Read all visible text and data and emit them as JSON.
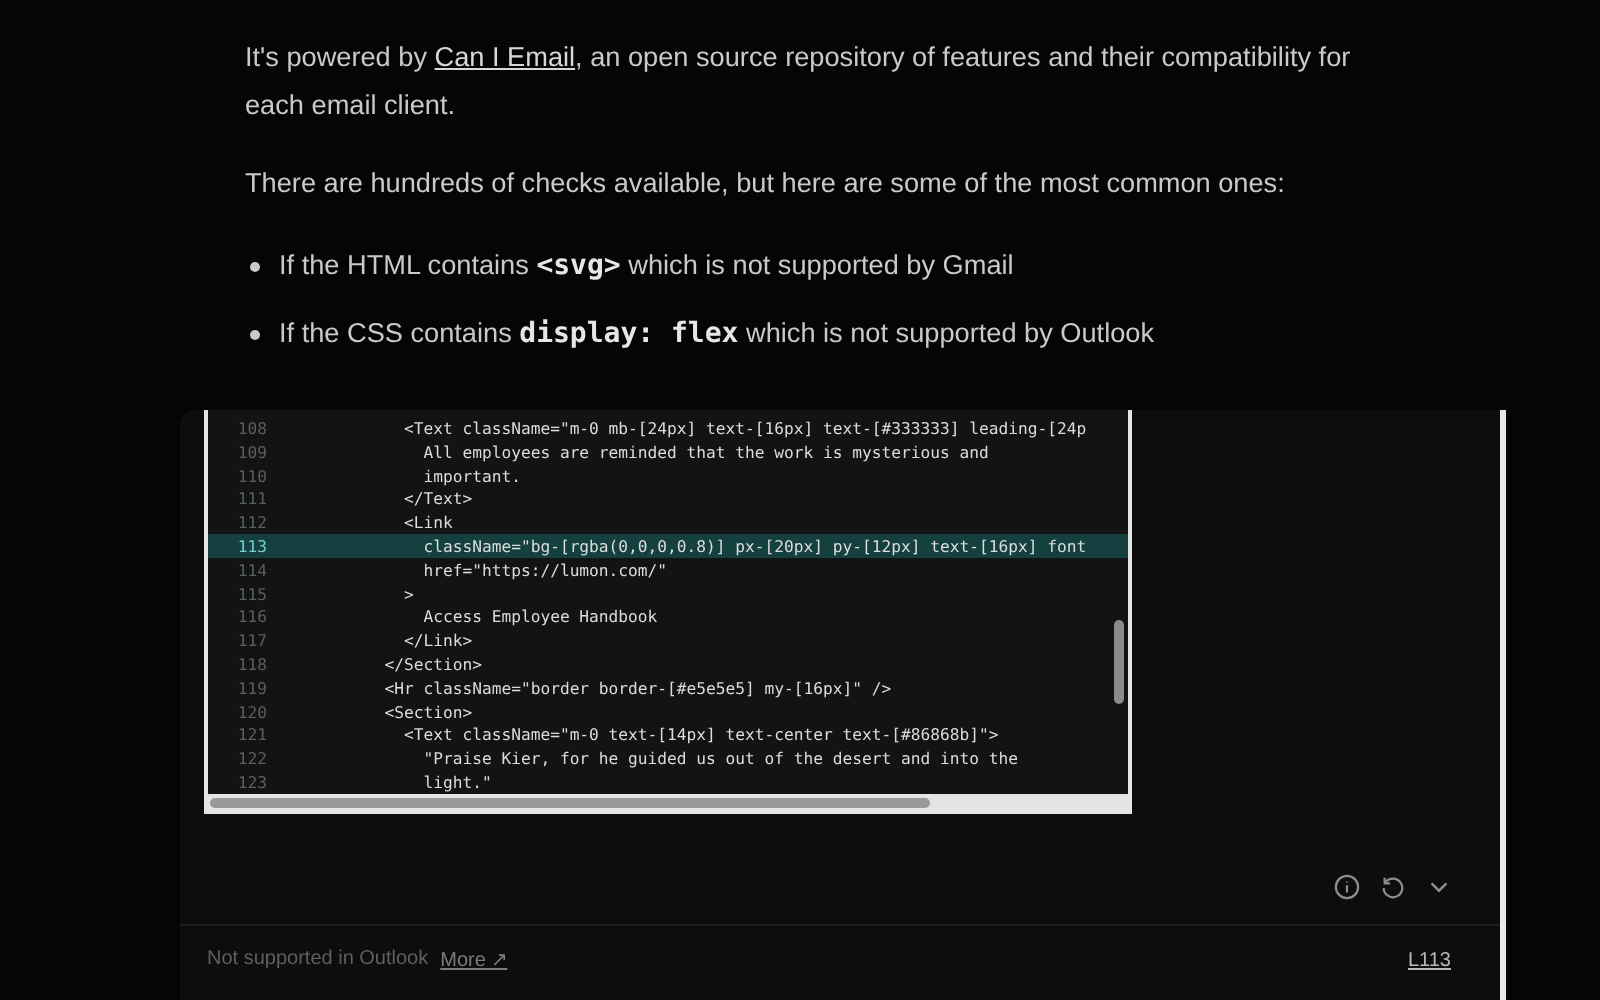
{
  "article": {
    "paragraphs": [
      [
        {
          "kind": "text",
          "text": "It's powered by "
        },
        {
          "kind": "link",
          "text": "Can I Email"
        },
        {
          "kind": "text",
          "text": ", an open source repository of features and their compatibility for each email client."
        }
      ],
      [
        {
          "kind": "text",
          "text": "There are hundreds of checks available, but here are some of the most common ones:"
        }
      ]
    ],
    "bullets": [
      [
        {
          "kind": "text",
          "text": "If the HTML contains "
        },
        {
          "kind": "code",
          "text": "<svg>"
        },
        {
          "kind": "text",
          "text": " which is not supported by Gmail"
        }
      ],
      [
        {
          "kind": "text",
          "text": "If the CSS contains "
        },
        {
          "kind": "code",
          "text": "display: flex"
        },
        {
          "kind": "text",
          "text": " which is not supported by Outlook"
        }
      ]
    ]
  },
  "code_preview": {
    "lines": [
      {
        "number": "108",
        "text": "            <Text className=\"m-0 mb-[24px] text-[16px] text-[#333333] leading-[24p",
        "selected": false
      },
      {
        "number": "109",
        "text": "              All employees are reminded that the work is mysterious and",
        "selected": false
      },
      {
        "number": "110",
        "text": "              important.",
        "selected": false
      },
      {
        "number": "111",
        "text": "            </Text>",
        "selected": false
      },
      {
        "number": "112",
        "text": "            <Link",
        "selected": false
      },
      {
        "number": "113",
        "text": "              className=\"bg-[rgba(0,0,0,0.8)] px-[20px] py-[12px] text-[16px] font",
        "selected": true
      },
      {
        "number": "114",
        "text": "              href=\"https://lumon.com/\"",
        "selected": false
      },
      {
        "number": "115",
        "text": "            >",
        "selected": false
      },
      {
        "number": "116",
        "text": "              Access Employee Handbook",
        "selected": false
      },
      {
        "number": "117",
        "text": "            </Link>",
        "selected": false
      },
      {
        "number": "118",
        "text": "          </Section>",
        "selected": false
      },
      {
        "number": "119",
        "text": "          <Hr className=\"border border-[#e5e5e5] my-[16px]\" />",
        "selected": false
      },
      {
        "number": "120",
        "text": "          <Section>",
        "selected": false
      },
      {
        "number": "121",
        "text": "            <Text className=\"m-0 text-[14px] text-center text-[#86868b]\">",
        "selected": false
      },
      {
        "number": "122",
        "text": "              \"Praise Kier, for he guided us out of the desert and into the",
        "selected": false
      },
      {
        "number": "123",
        "text": "              light.\"",
        "selected": false
      }
    ]
  },
  "issue": {
    "message": "Not supported in Outlook",
    "more_link": "More ↗",
    "line_link": "L113"
  }
}
